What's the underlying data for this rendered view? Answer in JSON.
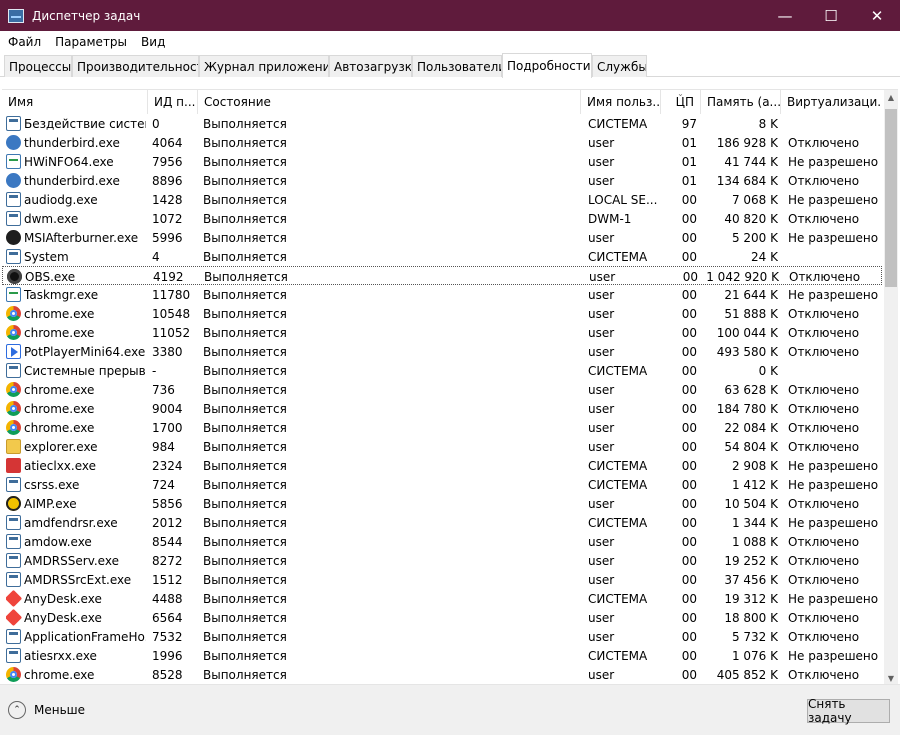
{
  "window": {
    "title": "Диспетчер задач",
    "controls": {
      "minimize": "—",
      "maximize": "☐",
      "close": "✕"
    }
  },
  "menu": [
    "Файл",
    "Параметры",
    "Вид"
  ],
  "tabs": [
    "Процессы",
    "Производительность",
    "Журнал приложений",
    "Автозагрузка",
    "Пользователи",
    "Подробности",
    "Службы"
  ],
  "active_tab": "Подробности",
  "columns": [
    "Имя",
    "ИД п...",
    "Состояние",
    "Имя польз...",
    "ЦП",
    "Память (а...",
    "Виртуализаци..."
  ],
  "sort_indicator": "⌄",
  "rows": [
    {
      "name": "Бездействие системы",
      "pid": "0",
      "state": "Выполняется",
      "user": "СИСТЕМА",
      "cpu": "97",
      "memory": "8 K",
      "virtualization": "",
      "icon": "window-icon"
    },
    {
      "name": "thunderbird.exe",
      "pid": "4064",
      "state": "Выполняется",
      "user": "user",
      "cpu": "01",
      "memory": "186 928 K",
      "virtualization": "Отключено",
      "icon": "thunderbird-icon"
    },
    {
      "name": "HWiNFO64.exe",
      "pid": "7956",
      "state": "Выполняется",
      "user": "user",
      "cpu": "01",
      "memory": "41 744 K",
      "virtualization": "Не разрешено",
      "icon": "hwinfo-icon"
    },
    {
      "name": "thunderbird.exe",
      "pid": "8896",
      "state": "Выполняется",
      "user": "user",
      "cpu": "01",
      "memory": "134 684 K",
      "virtualization": "Отключено",
      "icon": "thunderbird-icon"
    },
    {
      "name": "audiodg.exe",
      "pid": "1428",
      "state": "Выполняется",
      "user": "LOCAL SE...",
      "cpu": "00",
      "memory": "7 068 K",
      "virtualization": "Не разрешено",
      "icon": "window-icon"
    },
    {
      "name": "dwm.exe",
      "pid": "1072",
      "state": "Выполняется",
      "user": "DWM-1",
      "cpu": "00",
      "memory": "40 820 K",
      "virtualization": "Отключено",
      "icon": "window-icon"
    },
    {
      "name": "MSIAfterburner.exe",
      "pid": "5996",
      "state": "Выполняется",
      "user": "user",
      "cpu": "00",
      "memory": "5 200 K",
      "virtualization": "Не разрешено",
      "icon": "afterburner-icon"
    },
    {
      "name": "System",
      "pid": "4",
      "state": "Выполняется",
      "user": "СИСТЕМА",
      "cpu": "00",
      "memory": "24 K",
      "virtualization": "",
      "icon": "window-icon"
    },
    {
      "name": "OBS.exe",
      "pid": "4192",
      "state": "Выполняется",
      "user": "user",
      "cpu": "00",
      "memory": "1 042 920 K",
      "virtualization": "Отключено",
      "icon": "obs-icon",
      "focused": true
    },
    {
      "name": "Taskmgr.exe",
      "pid": "11780",
      "state": "Выполняется",
      "user": "user",
      "cpu": "00",
      "memory": "21 644 K",
      "virtualization": "Не разрешено",
      "icon": "taskmgr-icon"
    },
    {
      "name": "chrome.exe",
      "pid": "10548",
      "state": "Выполняется",
      "user": "user",
      "cpu": "00",
      "memory": "51 888 K",
      "virtualization": "Отключено",
      "icon": "chrome-icon"
    },
    {
      "name": "chrome.exe",
      "pid": "11052",
      "state": "Выполняется",
      "user": "user",
      "cpu": "00",
      "memory": "100 044 K",
      "virtualization": "Отключено",
      "icon": "chrome-icon"
    },
    {
      "name": "PotPlayerMini64.exe",
      "pid": "3380",
      "state": "Выполняется",
      "user": "user",
      "cpu": "00",
      "memory": "493 580 K",
      "virtualization": "Отключено",
      "icon": "potplayer-icon"
    },
    {
      "name": "Системные прерыв...",
      "pid": "-",
      "state": "Выполняется",
      "user": "СИСТЕМА",
      "cpu": "00",
      "memory": "0 K",
      "virtualization": "",
      "icon": "window-icon"
    },
    {
      "name": "chrome.exe",
      "pid": "736",
      "state": "Выполняется",
      "user": "user",
      "cpu": "00",
      "memory": "63 628 K",
      "virtualization": "Отключено",
      "icon": "chrome-icon"
    },
    {
      "name": "chrome.exe",
      "pid": "9004",
      "state": "Выполняется",
      "user": "user",
      "cpu": "00",
      "memory": "184 780 K",
      "virtualization": "Отключено",
      "icon": "chrome-icon"
    },
    {
      "name": "chrome.exe",
      "pid": "1700",
      "state": "Выполняется",
      "user": "user",
      "cpu": "00",
      "memory": "22 084 K",
      "virtualization": "Отключено",
      "icon": "chrome-icon"
    },
    {
      "name": "explorer.exe",
      "pid": "984",
      "state": "Выполняется",
      "user": "user",
      "cpu": "00",
      "memory": "54 804 K",
      "virtualization": "Отключено",
      "icon": "explorer-icon"
    },
    {
      "name": "atieclxx.exe",
      "pid": "2324",
      "state": "Выполняется",
      "user": "СИСТЕМА",
      "cpu": "00",
      "memory": "2 908 K",
      "virtualization": "Не разрешено",
      "icon": "amd-icon"
    },
    {
      "name": "csrss.exe",
      "pid": "724",
      "state": "Выполняется",
      "user": "СИСТЕМА",
      "cpu": "00",
      "memory": "1 412 K",
      "virtualization": "Не разрешено",
      "icon": "window-icon"
    },
    {
      "name": "AIMP.exe",
      "pid": "5856",
      "state": "Выполняется",
      "user": "user",
      "cpu": "00",
      "memory": "10 504 K",
      "virtualization": "Отключено",
      "icon": "aimp-icon"
    },
    {
      "name": "amdfendrsr.exe",
      "pid": "2012",
      "state": "Выполняется",
      "user": "СИСТЕМА",
      "cpu": "00",
      "memory": "1 344 K",
      "virtualization": "Не разрешено",
      "icon": "window-icon"
    },
    {
      "name": "amdow.exe",
      "pid": "8544",
      "state": "Выполняется",
      "user": "user",
      "cpu": "00",
      "memory": "1 088 K",
      "virtualization": "Отключено",
      "icon": "window-icon"
    },
    {
      "name": "AMDRSServ.exe",
      "pid": "8272",
      "state": "Выполняется",
      "user": "user",
      "cpu": "00",
      "memory": "19 252 K",
      "virtualization": "Отключено",
      "icon": "window-icon"
    },
    {
      "name": "AMDRSSrcExt.exe",
      "pid": "1512",
      "state": "Выполняется",
      "user": "user",
      "cpu": "00",
      "memory": "37 456 K",
      "virtualization": "Отключено",
      "icon": "window-icon"
    },
    {
      "name": "AnyDesk.exe",
      "pid": "4488",
      "state": "Выполняется",
      "user": "СИСТЕМА",
      "cpu": "00",
      "memory": "19 312 K",
      "virtualization": "Не разрешено",
      "icon": "anydesk-icon"
    },
    {
      "name": "AnyDesk.exe",
      "pid": "6564",
      "state": "Выполняется",
      "user": "user",
      "cpu": "00",
      "memory": "18 800 K",
      "virtualization": "Отключено",
      "icon": "anydesk-icon"
    },
    {
      "name": "ApplicationFrameHo...",
      "pid": "7532",
      "state": "Выполняется",
      "user": "user",
      "cpu": "00",
      "memory": "5 732 K",
      "virtualization": "Отключено",
      "icon": "window-icon"
    },
    {
      "name": "atiesrxx.exe",
      "pid": "1996",
      "state": "Выполняется",
      "user": "СИСТЕМА",
      "cpu": "00",
      "memory": "1 076 K",
      "virtualization": "Не разрешено",
      "icon": "window-icon"
    },
    {
      "name": "chrome.exe",
      "pid": "8528",
      "state": "Выполняется",
      "user": "user",
      "cpu": "00",
      "memory": "405 852 K",
      "virtualization": "Отключено",
      "icon": "chrome-icon"
    }
  ],
  "footer": {
    "fewer_label": "Меньше",
    "fewer_icon": "⌃",
    "end_task_label": "Снять задачу"
  },
  "scrollbar": {
    "up_arrow": "▲",
    "down_arrow": "▼"
  },
  "colors": {
    "titlebar": "#5f1b3c"
  }
}
